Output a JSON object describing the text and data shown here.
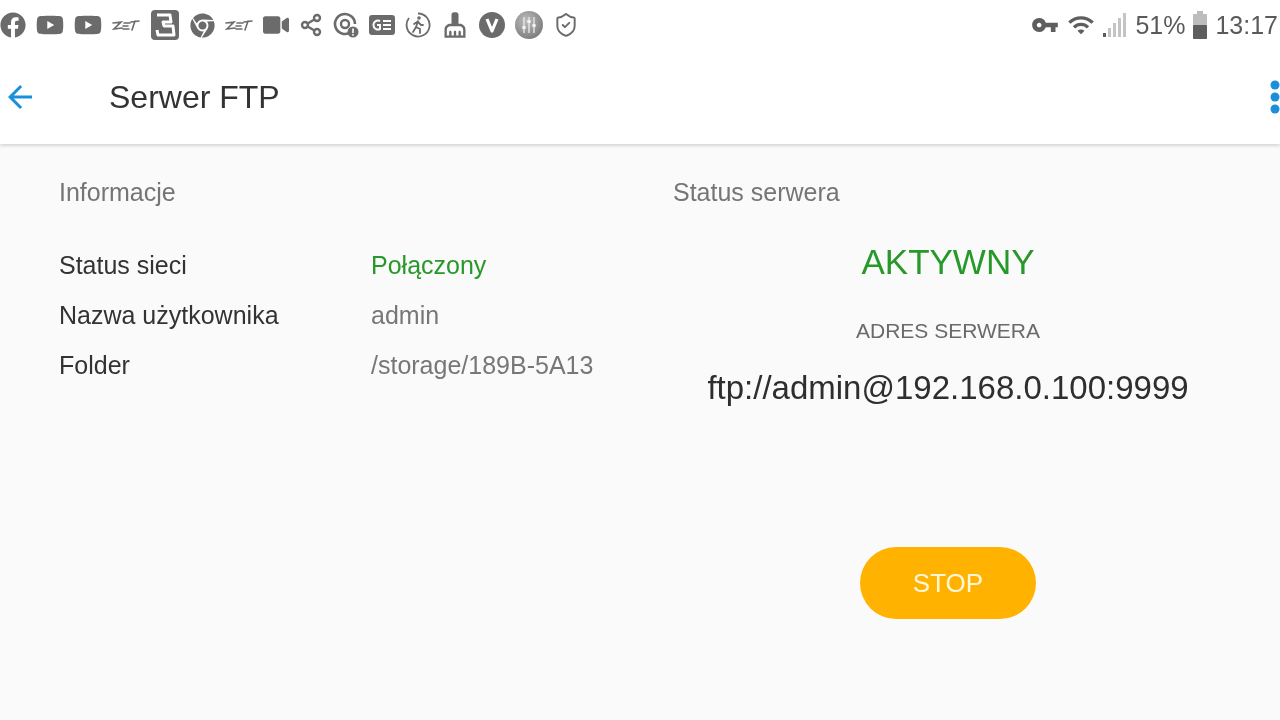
{
  "status_bar": {
    "battery": "51%",
    "time": "13:17"
  },
  "app_bar": {
    "title": "Serwer FTP"
  },
  "info": {
    "heading": "Informacje",
    "rows": [
      {
        "label": "Status sieci",
        "value": "Połączony",
        "kind": "status"
      },
      {
        "label": "Nazwa użytkownika",
        "value": "admin",
        "kind": "plain"
      },
      {
        "label": "Folder",
        "value": "/storage/189B-5A13",
        "kind": "plain"
      }
    ]
  },
  "server": {
    "heading": "Status serwera",
    "state": "AKTYWNY",
    "address_label": "ADRES SERWERA",
    "address": "ftp://admin@192.168.0.100:9999",
    "button": "STOP"
  }
}
